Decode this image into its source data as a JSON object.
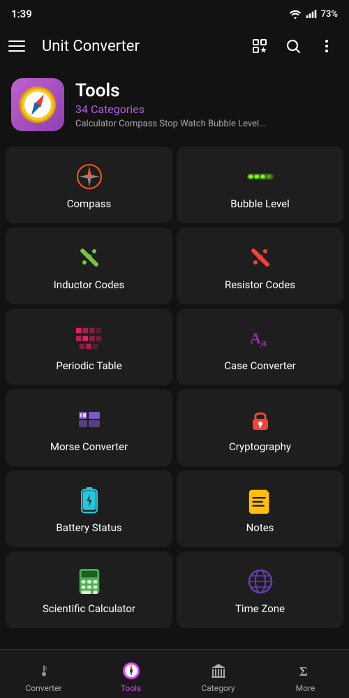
{
  "statusBar": {
    "time": "1:39",
    "battery": "73%"
  },
  "topBar": {
    "title": "Unit Converter",
    "menuLabel": "menu",
    "favoritesLabel": "favorites",
    "searchLabel": "search",
    "moreLabel": "more options"
  },
  "header": {
    "name": "Tools",
    "categories": "34 Categories",
    "description": "Calculator Compass Stop Watch Bubble Level..."
  },
  "grid": [
    {
      "id": "compass",
      "label": "Compass",
      "iconColor": "#ff5722"
    },
    {
      "id": "bubble-level",
      "label": "Bubble Level",
      "iconColor": "#76ff03"
    },
    {
      "id": "inductor-codes",
      "label": "Inductor Codes",
      "iconColor": "#76c442"
    },
    {
      "id": "resistor-codes",
      "label": "Resistor Codes",
      "iconColor": "#f44336"
    },
    {
      "id": "periodic-table",
      "label": "Periodic Table",
      "iconColor": "#e91e63"
    },
    {
      "id": "case-converter",
      "label": "Case Converter",
      "iconColor": "#9c27b0"
    },
    {
      "id": "morse-converter",
      "label": "Morse Converter",
      "iconColor": "#7e57c2"
    },
    {
      "id": "cryptography",
      "label": "Cryptography",
      "iconColor": "#f44336"
    },
    {
      "id": "battery-status",
      "label": "Battery Status",
      "iconColor": "#26c6da"
    },
    {
      "id": "notes",
      "label": "Notes",
      "iconColor": "#ffc107"
    },
    {
      "id": "scientific-calculator",
      "label": "Scientific Calculator",
      "iconColor": "#4caf50"
    },
    {
      "id": "time-zone",
      "label": "Time Zone",
      "iconColor": "#673ab7"
    }
  ],
  "bottomNav": [
    {
      "id": "thermometer",
      "label": "Converter",
      "active": false
    },
    {
      "id": "tools",
      "label": "Tools",
      "active": true
    },
    {
      "id": "bank",
      "label": "Category",
      "active": false
    },
    {
      "id": "sigma",
      "label": "More",
      "active": false
    }
  ]
}
